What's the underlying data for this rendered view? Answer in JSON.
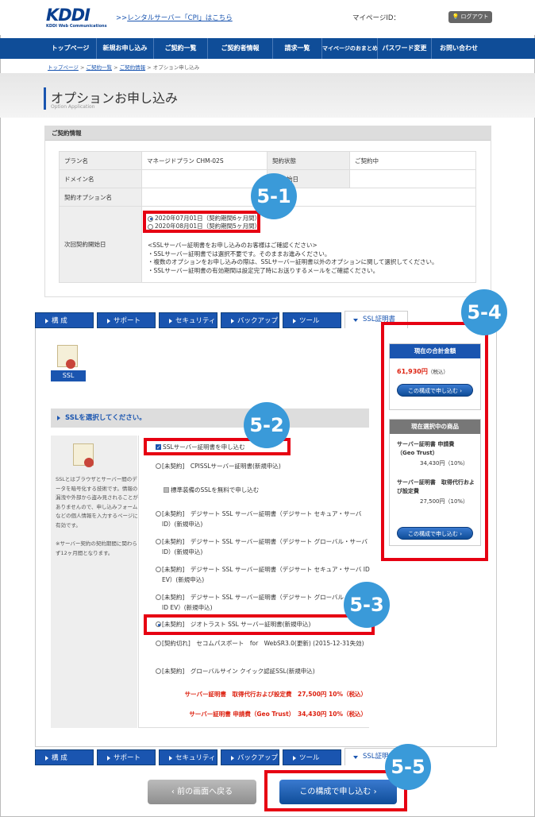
{
  "header": {
    "logo_text": "KDDI",
    "logo_sub": "KDDI Web Communications",
    "top_link_prefix": ">>",
    "top_link": "レンタルサーバー「CPI」はこちら",
    "mypage_id_label": "マイページID：",
    "logout_label": "ログアウト"
  },
  "nav": {
    "items": [
      "トップページ",
      "新規お申し込み",
      "ご契約一覧",
      "ご契約者情報",
      "請求一覧",
      "マイページのおまとめ",
      "パスワード変更",
      "お問い合わせ"
    ]
  },
  "breadcrumb": {
    "items": [
      "トップページ",
      "ご契約一覧",
      "ご契約情報"
    ],
    "separator": ">",
    "current": "オプション申し込み"
  },
  "page": {
    "title": "オプションお申し込み",
    "subtitle": "Option Application"
  },
  "contract": {
    "header": "ご契約情報",
    "plan_label": "プラン名",
    "plan_value": "マネージドプラン CHM-02S",
    "status_label": "契約状態",
    "status_value": "ご契約中",
    "domain_label": "ドメイン名",
    "date_label_tail": "始日",
    "option_label": "契約オプション名",
    "next_start_label": "次回契約開始日",
    "start_options": [
      "2020年07月01日（契約期間6ヶ月間）",
      "2020年08月01日（契約期間5ヶ月間）"
    ],
    "notes": [
      "<SSLサーバー証明書をお申し込みのお客様はご確認ください>",
      "・SSLサーバー証明書では選択不要です。そのままお進みください。",
      "・複数のオプションをお申し込みの際は、SSLサーバー証明書以外のオプションに関して選択してください。",
      "・SSLサーバー証明書の有効期間は設定完了時にお送りするメールをご確認ください。"
    ]
  },
  "tabs": [
    "構 成",
    "サポート",
    "セキュリティー",
    "バックアップ",
    "ツール",
    "SSL証明書"
  ],
  "ssl": {
    "icon_label": "SSL",
    "select_header": "SSLを選択してください。",
    "side_text": "SSLとはブラウザとサーバー間のデータを暗号化する技術です。情報の漏洩や外部から盗み見されることがありませんので、申し込みフォームなどの個人情報を入力するページに有効です。",
    "side_note": "※サーバー契約の契約期間に関わらず12ヶ月間となります。",
    "apply_checkbox": "SSLサーバー証明書を申し込む",
    "free_checkbox": "標準装備のSSLを無料で申し込む",
    "options": [
      "[未契約]　CPISSLサーバー証明書(新規申込)",
      "[未契約]　デジサート SSL サーバー証明書（デジサート セキュア・サーバ ID）(新規申込)",
      "[未契約]　デジサート SSL サーバー証明書（デジサート グローバル・サーバ ID）(新規申込)",
      "[未契約]　デジサート SSL サーバー証明書（デジサート セキュア・サーバ ID EV）(新規申込)",
      "[未契約]　デジサート SSL サーバー証明書（デジサート グローバル・サーバ ID EV）(新規申込)",
      "[未契約]　ジオトラスト SSL サーバー証明書(新規申込)",
      "[契約切れ]　セコムパスポート　for　WebSR3.0(更新) (2015-12-31失効)",
      "[未契約]　グローバルサイン クイック認証SSL(新規申込)"
    ],
    "selected_index": 5,
    "price_lines": [
      "サーバー証明書　取得代行および設定費　27,500円 10%（税込）",
      "サーバー証明書 申請費（Geo Trust）　34,430円 10%（税込）"
    ]
  },
  "summary": {
    "total_header": "現在の合計金額",
    "total_value": "61,930円",
    "total_suffix": "（税込）",
    "apply_button": "この構成で申し込む",
    "selected_header": "現在選択中の商品",
    "item1_name": "サーバー証明書 申請費（Geo Trust）",
    "item1_price": "34,430円（10%）",
    "item2_name": "サーバー証明書　取得代行および設定費",
    "item2_price": "27,500円（10%）"
  },
  "buttons": {
    "back": "前の画面へ戻る",
    "submit": "この構成で申し込む"
  },
  "callouts": [
    "5-1",
    "5-2",
    "5-3",
    "5-4",
    "5-5"
  ],
  "colors": {
    "brand": "#0f4d98",
    "highlight": "#e60012",
    "callout": "#3a9ad9"
  }
}
